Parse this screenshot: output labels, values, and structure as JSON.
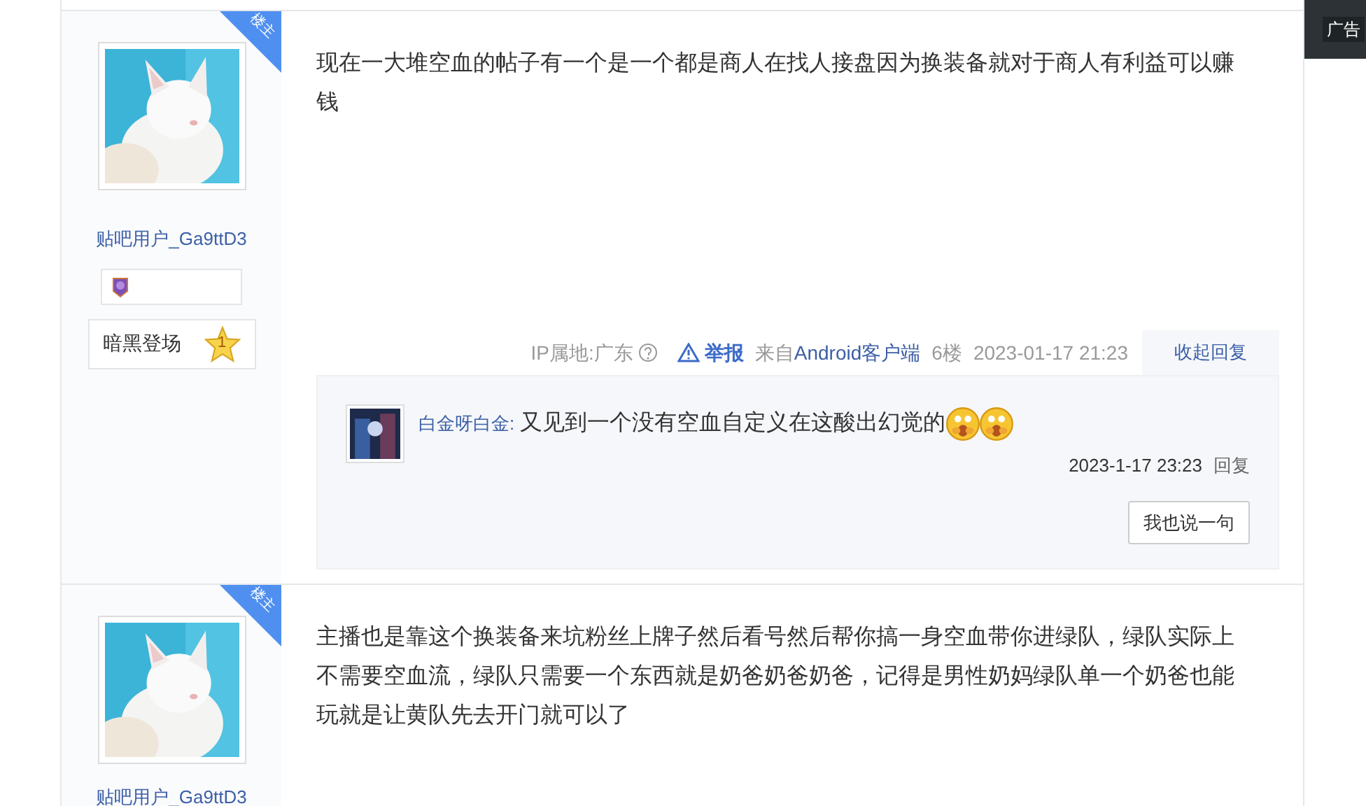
{
  "ad": {
    "label": "广告"
  },
  "posts": [
    {
      "badge": "楼主",
      "author": "贴吧用户_Ga9ttD3",
      "level_badge": true,
      "title": {
        "name": "暗黑登场",
        "star": "1"
      },
      "content": "现在一大堆空血的帖子有一个是一个都是商人在找人接盘因为换装备就对于商人有利益可以赚钱",
      "meta": {
        "ip": "IP属地:广东",
        "report": "举报",
        "from_prefix": "来自",
        "client": "Android客户端",
        "floor": "6楼",
        "time": "2023-01-17 21:23",
        "toggle": "收起回复"
      },
      "replies": [
        {
          "user": "白金呀白金:",
          "text": "又见到一个没有空血自定义在这酸出幻觉的",
          "emojis": [
            {
              "kind": "shocked"
            },
            {
              "kind": "shocked"
            }
          ],
          "time": "2023-1-17 23:23",
          "reply": "回复"
        }
      ],
      "say_button": "我也说一句"
    },
    {
      "badge": "楼主",
      "author": "贴吧用户_Ga9ttD3",
      "content": "主播也是靠这个换装备来坑粉丝上牌子然后看号然后帮你搞一身空血带你进绿队，绿队实际上不需要空血流，绿队只需要一个东西就是奶爸奶爸奶爸，记得是男性奶妈绿队单一个奶爸也能玩就是让黄队先去开门就可以了"
    }
  ]
}
